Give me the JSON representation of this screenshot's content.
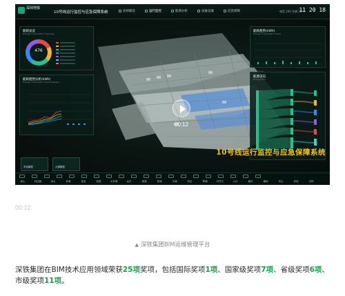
{
  "video": {
    "system_title": "10号线运行监控与应急保障系统",
    "logo_text": "深圳地铁",
    "clock": "11 20 18",
    "status_text": "电话 24h 空调 20℃",
    "nav_tabs": [
      "总体概览",
      "运行监控",
      "能源分析",
      "设备设施",
      "应急保障"
    ],
    "overlay_title": "10号线运行监控与应急保障系统",
    "time_display": "00:12",
    "left_panel_1": {
      "title": "能耗总览",
      "subtitle": "Energy consumption overview",
      "donut_value": "476"
    },
    "left_panel_2": {
      "title": "能耗趋势分析(kWh)",
      "subtitle": "Energy consumption trend analysis"
    },
    "right_panel_1": {
      "title": "能耗趋势(kWh)",
      "subtitle": "Energy consumption trend"
    },
    "right_panel_2": {
      "title": "能源流向",
      "subtitle": "Energy flow"
    },
    "mini_labels": [
      "车站模型",
      "大楼模型"
    ],
    "bottom_labels": [
      "南山",
      "科技园",
      "深大",
      "前海",
      "宝安",
      "西丽",
      "大学城",
      "龙华",
      "清湖",
      "观澜",
      "平湖",
      "布吉",
      "草埔",
      "丹竹头",
      "六约",
      "塘坑",
      "横岗",
      "坪山",
      "坪地",
      "坑梓",
      "双龙"
    ]
  },
  "timestamp": "00:12",
  "caption": "深铁集团BIM运维管理平台",
  "paragraph": {
    "p1": "深铁集团在BIM技术应用领域荣获",
    "n1": "25项",
    "p2": "奖项，包括国际奖项",
    "n2": "1项",
    "p3": "、国家级奖项",
    "n3": "7项",
    "p4": "、省级奖项",
    "n4": "6项",
    "p5": "、市级奖项",
    "n5": "11项",
    "p6": "。"
  },
  "colors": {
    "accent_green": "#14a043",
    "overlay_yellow": "#f4c21a",
    "ui_dark": "#05100d"
  }
}
